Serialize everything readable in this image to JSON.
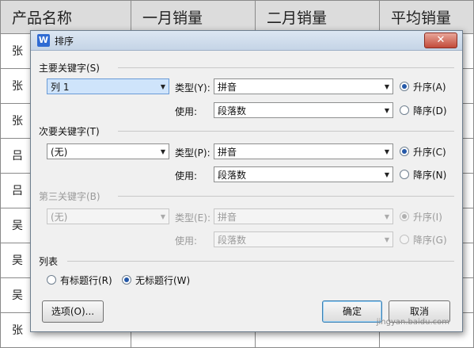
{
  "table": {
    "headers": [
      "产品名称",
      "一月销量",
      "二月销量",
      "平均销量"
    ],
    "first_column": [
      "张",
      "张",
      "张",
      "吕",
      "吕",
      "吴",
      "吴",
      "吴",
      "张"
    ]
  },
  "dialog": {
    "title": "排序",
    "close": "✕",
    "primary": {
      "section": "主要关键字(S)",
      "field": "列 1",
      "type_label": "类型(Y):",
      "type_value": "拼音",
      "use_label": "使用:",
      "use_value": "段落数",
      "asc": "升序(A)",
      "desc": "降序(D)"
    },
    "secondary": {
      "section": "次要关键字(T)",
      "field": "(无)",
      "type_label": "类型(P):",
      "type_value": "拼音",
      "use_label": "使用:",
      "use_value": "段落数",
      "asc": "升序(C)",
      "desc": "降序(N)"
    },
    "third": {
      "section": "第三关键字(B)",
      "field": "(无)",
      "type_label": "类型(E):",
      "type_value": "拼音",
      "use_label": "使用:",
      "use_value": "段落数",
      "asc": "升序(I)",
      "desc": "降序(G)"
    },
    "list": {
      "section": "列表",
      "has_header": "有标题行(R)",
      "no_header": "无标题行(W)"
    },
    "buttons": {
      "options": "选项(O)...",
      "ok": "确定",
      "cancel": "取消"
    },
    "watermark": "jingyan.baidu.com"
  },
  "colors": {
    "accent": "#2458a8",
    "highlight": "#cfe4fb",
    "close": "#c24a3a"
  }
}
